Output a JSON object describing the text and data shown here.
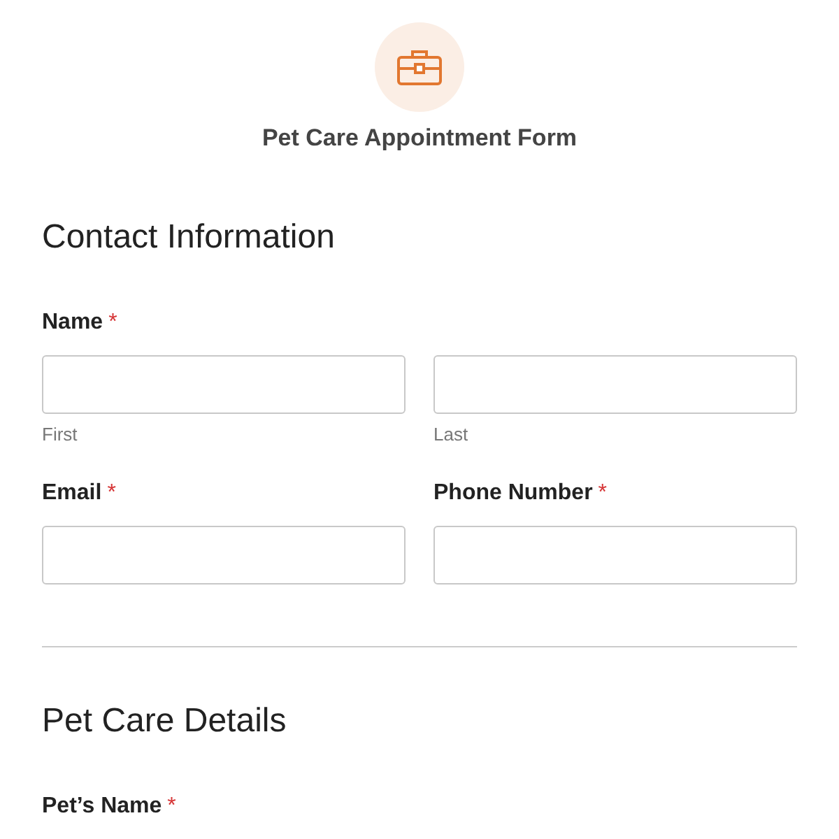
{
  "form": {
    "title": "Pet Care Appointment Form"
  },
  "sections": [
    {
      "heading": "Contact Information",
      "rows": [
        {
          "fields": [
            {
              "label": "Name",
              "required": true,
              "required_mark": "*",
              "inputs": [
                {
                  "kind": "text",
                  "sublabel": "First"
                },
                {
                  "kind": "text",
                  "sublabel": "Last"
                }
              ]
            }
          ]
        },
        {
          "fields": [
            {
              "label": "Email",
              "required": true,
              "required_mark": "*",
              "inputs": [
                {
                  "kind": "text"
                }
              ]
            },
            {
              "label": "Phone Number",
              "required": true,
              "required_mark": "*",
              "inputs": [
                {
                  "kind": "text"
                }
              ]
            }
          ]
        }
      ]
    },
    {
      "heading": "Pet Care Details",
      "rows": [
        {
          "fields": [
            {
              "label": "Pet’s Name",
              "required": true,
              "required_mark": "*"
            }
          ]
        }
      ]
    }
  ]
}
